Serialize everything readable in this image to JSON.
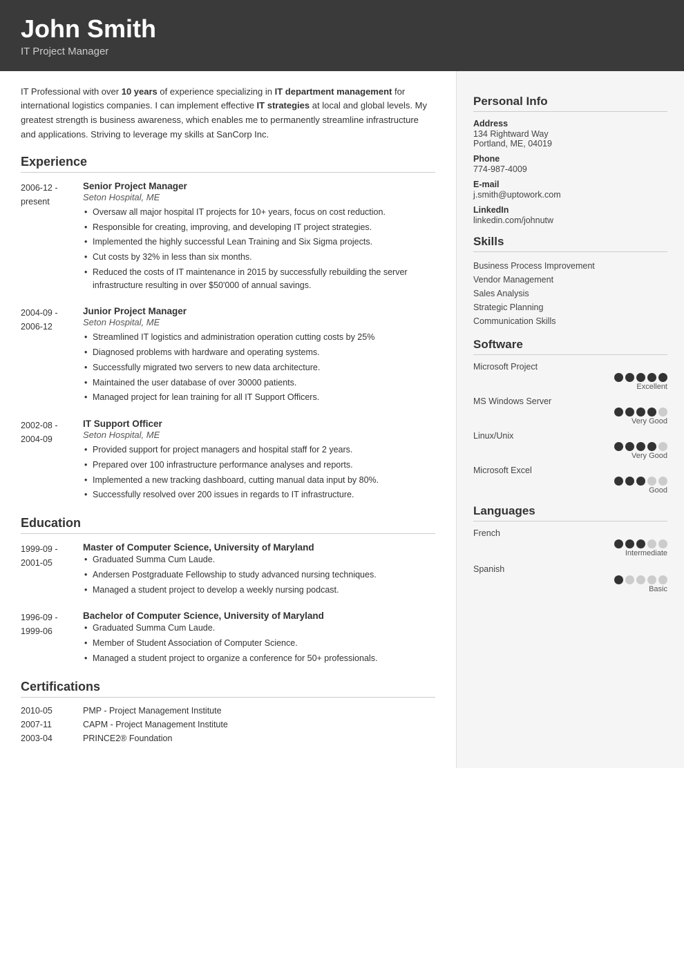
{
  "header": {
    "name": "John Smith",
    "title": "IT Project Manager"
  },
  "summary": {
    "text_parts": [
      {
        "text": "IT Professional with over ",
        "bold": false
      },
      {
        "text": "10 years",
        "bold": true
      },
      {
        "text": " of experience specializing in ",
        "bold": false
      },
      {
        "text": "IT department management",
        "bold": true
      },
      {
        "text": " for international logistics companies. I can implement effective ",
        "bold": false
      },
      {
        "text": "IT strategies",
        "bold": true
      },
      {
        "text": " at local and global levels. My greatest strength is business awareness, which enables me to permanently streamline infrastructure and applications. Striving to leverage my skills at SanCorp Inc.",
        "bold": false
      }
    ]
  },
  "sections": {
    "experience_label": "Experience",
    "education_label": "Education",
    "certifications_label": "Certifications"
  },
  "experience": [
    {
      "date_start": "2006-12 -",
      "date_end": "present",
      "title": "Senior Project Manager",
      "company": "Seton Hospital, ME",
      "bullets": [
        "Oversaw all major hospital IT projects for 10+ years, focus on cost reduction.",
        "Responsible for creating, improving, and developing IT project strategies.",
        "Implemented the highly successful Lean Training and Six Sigma projects.",
        "Cut costs by 32% in less than six months.",
        "Reduced the costs of IT maintenance in 2015 by successfully rebuilding the server infrastructure resulting in over $50'000 of annual savings."
      ]
    },
    {
      "date_start": "2004-09 -",
      "date_end": "2006-12",
      "title": "Junior Project Manager",
      "company": "Seton Hospital, ME",
      "bullets": [
        "Streamlined IT logistics and administration operation cutting costs by 25%",
        "Diagnosed problems with hardware and operating systems.",
        "Successfully migrated two servers to new data architecture.",
        "Maintained the user database of over 30000 patients.",
        "Managed project for lean training for all IT Support Officers."
      ]
    },
    {
      "date_start": "2002-08 -",
      "date_end": "2004-09",
      "title": "IT Support Officer",
      "company": "Seton Hospital, ME",
      "bullets": [
        "Provided support for project managers and hospital staff for 2 years.",
        "Prepared over 100 infrastructure performance analyses and reports.",
        "Implemented a new tracking dashboard, cutting manual data input by 80%.",
        "Successfully resolved over 200 issues in regards to IT infrastructure."
      ]
    }
  ],
  "education": [
    {
      "date_start": "1999-09 -",
      "date_end": "2001-05",
      "title": "Master of Computer Science, University of Maryland",
      "bullets": [
        "Graduated Summa Cum Laude.",
        "Andersen Postgraduate Fellowship to study advanced nursing techniques.",
        "Managed a student project to develop a weekly nursing podcast."
      ]
    },
    {
      "date_start": "1996-09 -",
      "date_end": "1999-06",
      "title": "Bachelor of Computer Science, University of Maryland",
      "bullets": [
        "Graduated Summa Cum Laude.",
        "Member of Student Association of Computer Science.",
        "Managed a student project to organize a conference for 50+ professionals."
      ]
    }
  ],
  "certifications": [
    {
      "date": "2010-05",
      "desc": "PMP - Project Management Institute"
    },
    {
      "date": "2007-11",
      "desc": "CAPM - Project Management Institute"
    },
    {
      "date": "2003-04",
      "desc": "PRINCE2® Foundation"
    }
  ],
  "personal_info": {
    "label": "Personal Info",
    "fields": [
      {
        "label": "Address",
        "value": "134 Rightward Way\nPortland, ME, 04019"
      },
      {
        "label": "Phone",
        "value": "774-987-4009"
      },
      {
        "label": "E-mail",
        "value": "j.smith@uptowork.com"
      },
      {
        "label": "LinkedIn",
        "value": "linkedin.com/johnutw"
      }
    ]
  },
  "skills": {
    "label": "Skills",
    "items": [
      "Business Process Improvement",
      "Vendor Management",
      "Sales Analysis",
      "Strategic Planning",
      "Communication Skills"
    ]
  },
  "software": {
    "label": "Software",
    "items": [
      {
        "name": "Microsoft Project",
        "filled": 5,
        "total": 5,
        "level": "Excellent"
      },
      {
        "name": "MS Windows Server",
        "filled": 4,
        "total": 5,
        "level": "Very Good"
      },
      {
        "name": "Linux/Unix",
        "filled": 4,
        "total": 5,
        "level": "Very Good"
      },
      {
        "name": "Microsoft Excel",
        "filled": 3,
        "total": 5,
        "level": "Good"
      }
    ]
  },
  "languages": {
    "label": "Languages",
    "items": [
      {
        "name": "French",
        "filled": 3,
        "total": 5,
        "level": "Intermediate"
      },
      {
        "name": "Spanish",
        "filled": 1,
        "total": 5,
        "level": "Basic"
      }
    ]
  }
}
